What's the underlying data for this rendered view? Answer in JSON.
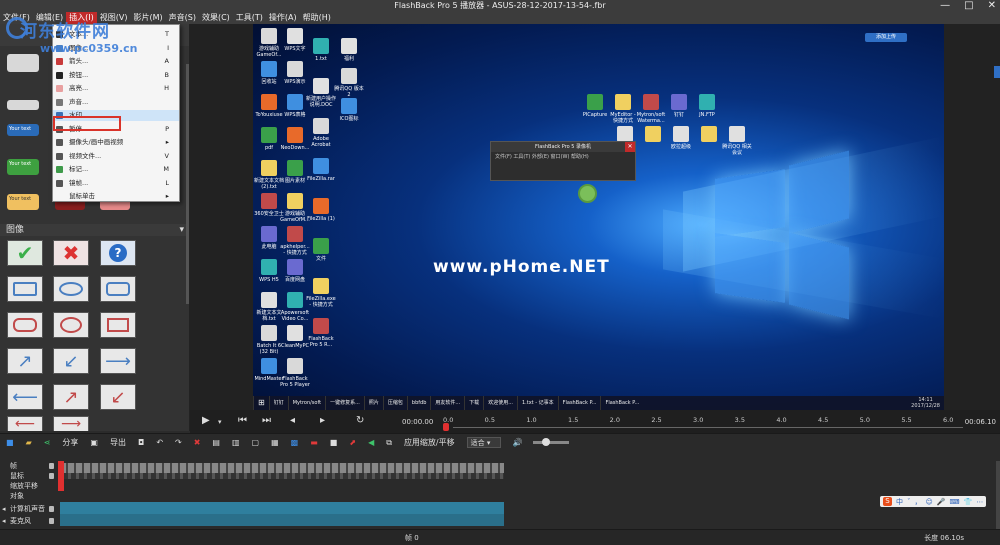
{
  "window": {
    "title": "FlashBack Pro 5 播放器 - ASUS-28-12-2017-13-54-.fbr",
    "controls": [
      "—",
      "□",
      "✕"
    ]
  },
  "menubar": [
    {
      "label": "文件(F)",
      "active": false
    },
    {
      "label": "编辑(E)",
      "active": false
    },
    {
      "label": "插入(I)",
      "active": true
    },
    {
      "label": "视图(V)",
      "active": false
    },
    {
      "label": "影片(M)",
      "active": false
    },
    {
      "label": "声音(S)",
      "active": false
    },
    {
      "label": "效果(C)",
      "active": false
    },
    {
      "label": "工具(T)",
      "active": false
    },
    {
      "label": "操作(A)",
      "active": false
    },
    {
      "label": "帮助(H)",
      "active": false
    }
  ],
  "site_watermark": {
    "line1": "河东软件网",
    "line2": "www.pc0359.cn"
  },
  "insert_menu": [
    {
      "label": "文本...",
      "key": "T",
      "icon": "text-icon",
      "color": "#333333"
    },
    {
      "label": "图像...",
      "key": "I",
      "icon": "image-icon",
      "color": "#4a7fc1"
    },
    {
      "label": "箭头...",
      "key": "A",
      "icon": "arrow-icon",
      "color": "#c83a3a"
    },
    {
      "label": "按钮...",
      "key": "B",
      "icon": "button-icon",
      "color": "#222222"
    },
    {
      "label": "高亮...",
      "key": "H",
      "icon": "highlight-icon",
      "color": "#e8a0a0"
    },
    {
      "label": "声音...",
      "key": "",
      "icon": "sound-icon",
      "color": "#777777"
    },
    {
      "label": "水印...",
      "key": "",
      "icon": "watermark-icon",
      "color": "#3a6fb5",
      "highlighted": true
    },
    {
      "label": "暂停...",
      "key": "P",
      "icon": "pause-icon",
      "color": "#555555"
    },
    {
      "label": "摄像头/画中画视频",
      "key": "▸",
      "icon": "camera-icon",
      "color": "#555555"
    },
    {
      "label": "视频文件...",
      "key": "V",
      "icon": "video-file-icon",
      "color": "#555555"
    },
    {
      "label": "标记...",
      "key": "M",
      "icon": "marker-icon",
      "color": "#3e9a4a"
    },
    {
      "label": "镜帧...",
      "key": "L",
      "icon": "frame-icon",
      "color": "#555555"
    },
    {
      "label": "鼠标单击",
      "key": "▸",
      "icon": "",
      "color": ""
    }
  ],
  "left_panel": {
    "section_label": "图像",
    "swatches": [
      "Your text",
      "Your text",
      "Your text",
      "Your text"
    ]
  },
  "desktop": {
    "watermark_text": "www.pHome.NET",
    "topright_button": "添加上传",
    "icons_col1": [
      "游戏辅助 GameOf...",
      "回收站",
      "ToYouxiuse",
      "pdf",
      "新建文本文档 (2).txt",
      "360安全卫士",
      "此电脑",
      "WPS H5",
      "新建文本文档.txt",
      "Batch It 6 (32 Bit)",
      "MindMaster"
    ],
    "icons_col2": [
      "WPS文字",
      "WPS演示",
      "WPS表格",
      "NeoDown...",
      "图片素材",
      "游戏辅助 GameOfM...",
      "apkhelper... - 快捷方式",
      "百度网盘",
      "Apowersoft Video Co...",
      "CleanMyPC",
      "FlashBack Pro 5 Player"
    ],
    "icons_col3": [
      "1.txt",
      "新建用户操作说明.DOC",
      "Adobe Acrobat",
      "FileZilla.rar",
      "FileZilla (1)",
      "文件",
      "FileZilla.exe - 快捷方式",
      "FlashBack Pro 5 R..."
    ],
    "icons_col4": [
      "福利",
      "腾讯QQ 版本2",
      "ICO图标"
    ],
    "icons_right": [
      "PICapture",
      "MyEditor - 快捷方式",
      "Mytron/soft Waterma...",
      "钉钉",
      "JN.FTP"
    ],
    "icons_right2": [
      "",
      "",
      "欧拉超级",
      "",
      "腾讯QQ 相关会议"
    ],
    "recorder": {
      "title": "FlashBack Pro 5 录像机",
      "menu": "文件(F)  工具(T)  外部(E)  窗口(W)  帮助(H)"
    },
    "taskbar": [
      "钉钉",
      "Mytron/soft",
      "一键修复系...",
      "照片",
      "压缩包",
      "bbfdb",
      "用友软件...",
      "下载",
      "欢迎使用...",
      "1.txt - 记事本",
      "FlashBack P...",
      "FlashBack P..."
    ],
    "clock": {
      "time": "14:11",
      "date": "2017/12/28"
    }
  },
  "playback": {
    "time": "00:00.00",
    "ticks": [
      "0.0",
      "0.5",
      "1.0",
      "1.5",
      "2.0",
      "2.5",
      "3.0",
      "3.5",
      "4.0",
      "4.5",
      "5.0",
      "5.5",
      "6.0"
    ],
    "end_time": "00:06.10",
    "position": 0
  },
  "toolbar": {
    "share": "分享",
    "export": "导出",
    "apply_zoom": "应用缩放/平移",
    "zoom_value": "适合",
    "volume": 0.3
  },
  "timeline": {
    "tracks": [
      "帧",
      "鼠标",
      "缩放平移",
      "对象"
    ],
    "audio_tracks": [
      "计算机声音",
      "麦克风"
    ],
    "frame_label": "帧 0",
    "length_label": "长度 06.10s",
    "ime": [
      "S",
      "中",
      "ˇ",
      "，",
      "☺",
      "🎤",
      "⌨",
      "👕",
      "⋯"
    ]
  }
}
